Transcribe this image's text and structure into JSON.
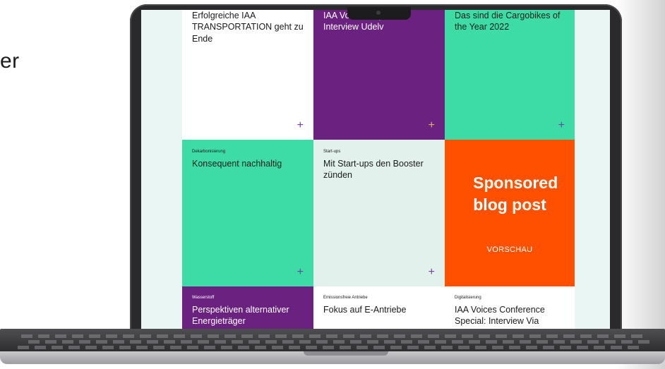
{
  "side_text": "er",
  "colors": {
    "purple": "#6a2180",
    "green": "#3ddca6",
    "orange": "#ff5000",
    "mint": "#e3f1ec",
    "plus_purple": "#7a3ab0",
    "plus_gold": "#e0b63a"
  },
  "tiles": [
    {
      "category": "",
      "title": "Erfolgreiche IAA TRANSPORTATION geht zu Ende",
      "plus": "+"
    },
    {
      "category": "",
      "title": "IAA Vo… ce Special: Interview Udelv",
      "plus": "+"
    },
    {
      "category": "",
      "title": "Das sind die Cargobikes of the Year 2022",
      "plus": "+"
    },
    {
      "category": "Dekarbonisierung",
      "title": "Konsequent nachhaltig",
      "plus": "+"
    },
    {
      "category": "Start-ups",
      "title": "Mit Start-ups den Booster zünden",
      "plus": "+"
    },
    {
      "category": "",
      "title": "Sponsored blog post",
      "cta": "VORSCHAU"
    },
    {
      "category": "Wasserstoff",
      "title": "Perspektiven alternativer Energieträger"
    },
    {
      "category": "Emissionsfreie Antriebe",
      "title": "Fokus auf E-Antriebe"
    },
    {
      "category": "Digitalisierung",
      "title": "IAA Voices Conference Special: Interview Via"
    }
  ]
}
